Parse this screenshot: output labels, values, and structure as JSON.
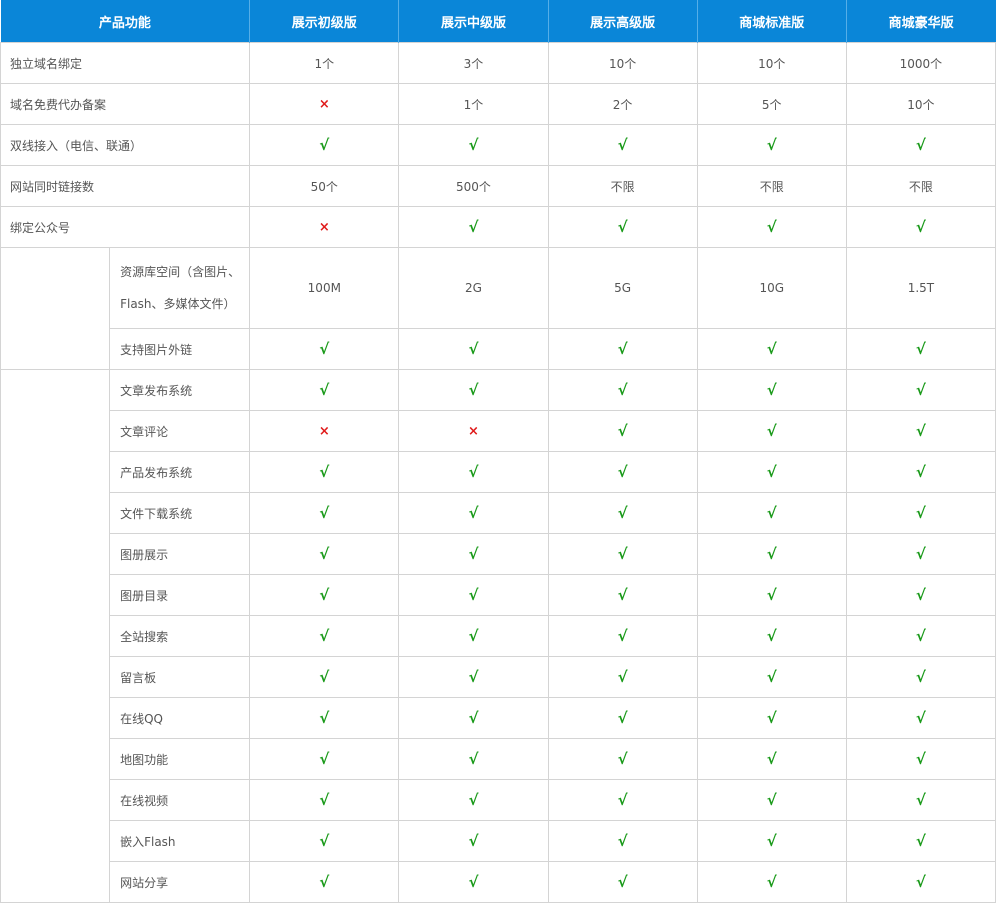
{
  "header": {
    "feature": "产品功能",
    "plans": [
      "展示初级版",
      "展示中级版",
      "展示高级版",
      "商城标准版",
      "商城豪华版"
    ]
  },
  "symbols": {
    "yes": "√",
    "no": "×"
  },
  "colors": {
    "header_bg": "#0a86d8",
    "yes": "#1a9a1a",
    "no": "#e01b1b"
  },
  "top_rows": [
    {
      "label": "独立域名绑定",
      "values": [
        "1个",
        "3个",
        "10个",
        "10个",
        "1000个"
      ]
    },
    {
      "label": "域名免费代办备案",
      "values": [
        "no",
        "1个",
        "2个",
        "5个",
        "10个"
      ]
    },
    {
      "label": "双线接入（电信、联通）",
      "values": [
        "yes",
        "yes",
        "yes",
        "yes",
        "yes"
      ]
    },
    {
      "label": "网站同时链接数",
      "values": [
        "50个",
        "500个",
        "不限",
        "不限",
        "不限"
      ]
    },
    {
      "label": "绑定公众号",
      "values": [
        "no",
        "yes",
        "yes",
        "yes",
        "yes"
      ]
    }
  ],
  "group1_rows": [
    {
      "label_line1": "资源库空间（含图片、",
      "label_line2": "Flash、多媒体文件）",
      "values": [
        "100M",
        "2G",
        "5G",
        "10G",
        "1.5T"
      ]
    },
    {
      "label": "支持图片外链",
      "values": [
        "yes",
        "yes",
        "yes",
        "yes",
        "yes"
      ]
    }
  ],
  "group2_rows": [
    {
      "label": "文章发布系统",
      "values": [
        "yes",
        "yes",
        "yes",
        "yes",
        "yes"
      ]
    },
    {
      "label": "文章评论",
      "values": [
        "no",
        "no",
        "yes",
        "yes",
        "yes"
      ]
    },
    {
      "label": "产品发布系统",
      "values": [
        "yes",
        "yes",
        "yes",
        "yes",
        "yes"
      ]
    },
    {
      "label": "文件下载系统",
      "values": [
        "yes",
        "yes",
        "yes",
        "yes",
        "yes"
      ]
    },
    {
      "label": "图册展示",
      "values": [
        "yes",
        "yes",
        "yes",
        "yes",
        "yes"
      ]
    },
    {
      "label": "图册目录",
      "values": [
        "yes",
        "yes",
        "yes",
        "yes",
        "yes"
      ]
    },
    {
      "label": "全站搜索",
      "values": [
        "yes",
        "yes",
        "yes",
        "yes",
        "yes"
      ]
    },
    {
      "label": "留言板",
      "values": [
        "yes",
        "yes",
        "yes",
        "yes",
        "yes"
      ]
    },
    {
      "label": "在线QQ",
      "values": [
        "yes",
        "yes",
        "yes",
        "yes",
        "yes"
      ]
    },
    {
      "label": "地图功能",
      "values": [
        "yes",
        "yes",
        "yes",
        "yes",
        "yes"
      ]
    },
    {
      "label": "在线视频",
      "values": [
        "yes",
        "yes",
        "yes",
        "yes",
        "yes"
      ]
    },
    {
      "label": "嵌入Flash",
      "values": [
        "yes",
        "yes",
        "yes",
        "yes",
        "yes"
      ]
    },
    {
      "label": "网站分享",
      "values": [
        "yes",
        "yes",
        "yes",
        "yes",
        "yes"
      ]
    }
  ]
}
